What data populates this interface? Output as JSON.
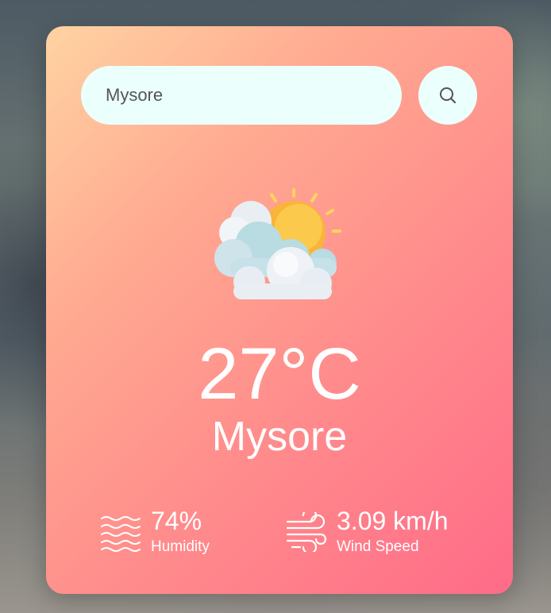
{
  "search": {
    "value": "Mysore",
    "placeholder": "",
    "icon": "search-icon"
  },
  "weather": {
    "icon": "partly-cloudy-icon",
    "temperature": "27°C",
    "city": "Mysore"
  },
  "details": {
    "humidity": {
      "icon": "humidity-waves-icon",
      "value": "74%",
      "label": "Humidity"
    },
    "wind": {
      "icon": "wind-icon",
      "value": "3.09 km/h",
      "label": "Wind Speed"
    }
  },
  "colors": {
    "card_gradient_start": "#ffd3a2",
    "card_gradient_end": "#ff6b88",
    "input_background": "#ebfffc",
    "text": "#ffffff"
  }
}
